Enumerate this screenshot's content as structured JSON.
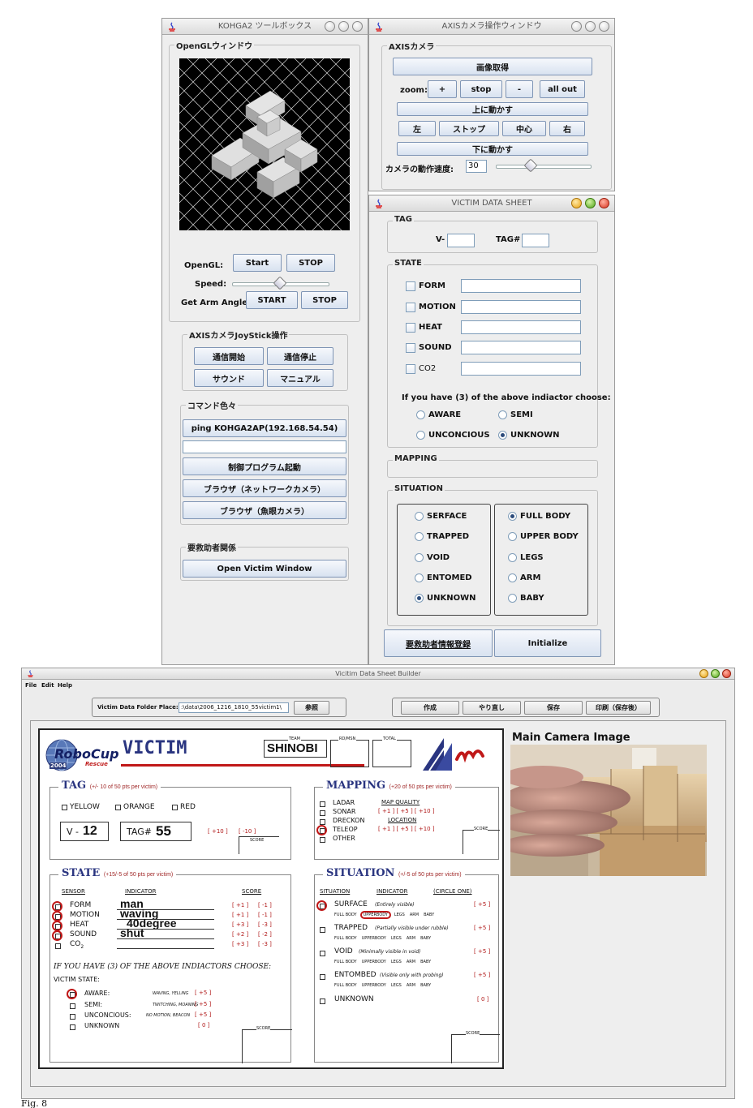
{
  "toolbox": {
    "title": "KOHGA2 ツールボックス",
    "opengl": {
      "group": "OpenGLウィンドウ",
      "label": "OpenGL:",
      "start": "Start",
      "stop": "STOP",
      "speed_label": "Speed:",
      "arm_label": "Get Arm Angle:",
      "arm_start": "START",
      "arm_stop": "STOP"
    },
    "joystick": {
      "group": "AXISカメラJoyStick操作",
      "connect": "通信開始",
      "disconnect": "通信停止",
      "sound": "サウンド",
      "manual": "マニュアル"
    },
    "commands": {
      "group": "コマンド色々",
      "ping": "ping KOHGA2AP(192.168.54.54)",
      "input": "",
      "launch": "制御プログラム起動",
      "browser_net": "ブラウザ（ネットワークカメラ）",
      "browser_fish": "ブラウザ（魚眼カメラ）"
    },
    "victim": {
      "group": "要救助者関係",
      "open": "Open Victim Window"
    }
  },
  "axis": {
    "title": "AXISカメラ操作ウィンドウ",
    "group": "AXISカメラ",
    "capture": "画像取得",
    "zoom_label": "zoom:",
    "zoom_in": "+",
    "zoom_stop": "stop",
    "zoom_out": "-",
    "all_out": "all out",
    "up": "上に動かす",
    "left": "左",
    "stop": "ストップ",
    "center": "中心",
    "right": "右",
    "down": "下に動かす",
    "speed_label": "カメラの動作速度:",
    "speed_value": "30",
    "speed_level": 0.35
  },
  "vds": {
    "title": "VICTIM DATA SHEET",
    "tag": {
      "group": "TAG",
      "v_label": "V-",
      "v_value": "",
      "tag_label": "TAG#",
      "tag_value": ""
    },
    "state": {
      "group": "STATE",
      "items": [
        {
          "label": "FORM",
          "value": ""
        },
        {
          "label": "MOTION",
          "value": ""
        },
        {
          "label": "HEAT",
          "value": ""
        },
        {
          "label": "SOUND",
          "value": ""
        },
        {
          "label": "CO2",
          "value": ""
        }
      ],
      "prompt": "If you have (3) of the above indiactor choose:",
      "aware": "AWARE",
      "semi": "SEMI",
      "unconscious": "UNCONCIOUS",
      "unknown": "UNKNOWN"
    },
    "mapping": {
      "group": "MAPPING"
    },
    "situation": {
      "group": "SITUATION",
      "left": [
        "SERFACE",
        "TRAPPED",
        "VOID",
        "ENTOMED",
        "UNKNOWN"
      ],
      "right": [
        "FULL BODY",
        "UPPER BODY",
        "LEGS",
        "ARM",
        "BABY"
      ]
    },
    "register": "要救助者情報登録",
    "initialize": "Initialize"
  },
  "builder": {
    "title": "Vicitim Data Sheet Builder",
    "menu": [
      "File",
      "Edit",
      "Help"
    ],
    "folder_label": "Victim Data Folder Place:",
    "folder_value": ":\\data\\2006_1216_1810_55victim1\\",
    "browse": "参照",
    "create": "作成",
    "redo": "やり直し",
    "save": "保存",
    "print": "印刷（保存後）",
    "camera_label": "Main Camera Image"
  },
  "sheet": {
    "logo_robo": "RoboCup",
    "logo_year": "2004",
    "logo_rescue": "Rescue",
    "victim": "VICTIM",
    "team_label": "TEAM",
    "team": "SHINOBI",
    "round_label": "RD/MSN",
    "total_label": "TOTAL",
    "tag": {
      "title": "TAG",
      "note": "(+/- 10 of 50 pts per victim)",
      "yellow": "YELLOW",
      "orange": "ORANGE",
      "red": "RED",
      "v": "V -",
      "v_value": "12",
      "tag": "TAG#",
      "tag_value": "55",
      "s1": "[ +10 ]",
      "s2": "[ -10 ]",
      "score": "SCORE"
    },
    "mapping": {
      "title": "MAPPING",
      "note": "(+20 of 50 pts per victim)",
      "items": [
        "LADAR",
        "SONAR",
        "DRECKON",
        "TELEOP",
        "OTHER"
      ],
      "quality": "MAP QUALITY",
      "location": "LOCATION",
      "s_row": "[ +1 ] [ +5 ] [ +10 ]",
      "score": "SCORE"
    },
    "state": {
      "title": "STATE",
      "note": "(+15/-5 of 50 pts per victim)",
      "h_sensor": "SENSOR",
      "h_indicator": "INDICATOR",
      "h_score": "SCORE",
      "rows": [
        {
          "label": "FORM",
          "value": "man",
          "plus": "[ +1 ]",
          "minus": "[ -1 ]"
        },
        {
          "label": "MOTION",
          "value": "waving",
          "plus": "[ +1 ]",
          "minus": "[ -1 ]"
        },
        {
          "label": "HEAT",
          "value": "40degree",
          "plus": "[ +3 ]",
          "minus": "[ -3 ]"
        },
        {
          "label": "SOUND",
          "value": "shut",
          "plus": "[ +2 ]",
          "minus": "[ -2 ]"
        },
        {
          "label": "CO",
          "value": "",
          "plus": "[ +3 ]",
          "minus": "[ -3 ]"
        }
      ],
      "co_sub": "2",
      "prompt": "IF YOU HAVE (3) OF THE ABOVE INDIACTORS CHOOSE:",
      "vs_label": "VICTIM STATE:",
      "vs": [
        {
          "label": "AWARE:",
          "desc": "WAVING, YELLING",
          "pts": "[ +5 ]"
        },
        {
          "label": "SEMI:",
          "desc": "TWITCHING, MOANING",
          "pts": "[ +5 ]"
        },
        {
          "label": "UNCONCIOUS:",
          "desc": "NO MOTION, BEACON",
          "pts": "[ +5 ]"
        },
        {
          "label": "UNKNOWN",
          "desc": "",
          "pts": "[ 0 ]"
        }
      ],
      "score": "SCORE"
    },
    "situation": {
      "title": "SITUATION",
      "note": "(+/-5 of 50 pts per victim)",
      "h1": "SITUATION",
      "h2": "INDICATOR",
      "h3": "(CIRCLE ONE)",
      "rows": [
        {
          "label": "SURFACE",
          "desc": "(Entirely visible)",
          "pts": "[ +5 ]"
        },
        {
          "label": "TRAPPED",
          "desc": "(Partially visible under rubble)",
          "pts": "[ +5 ]"
        },
        {
          "label": "VOID",
          "desc": "(Minimally visible in void)",
          "pts": "[ +5 ]"
        },
        {
          "label": "ENTOMBED",
          "desc": "(Visible only with probing)",
          "pts": "[ +5 ]"
        },
        {
          "label": "UNKNOWN",
          "desc": "",
          "pts": "[ 0 ]"
        }
      ],
      "body": [
        "FULL BODY",
        "UPPERBODY",
        "LEGS",
        "ARM",
        "BABY"
      ],
      "score": "SCORE"
    }
  },
  "caption": "Fig. 8"
}
